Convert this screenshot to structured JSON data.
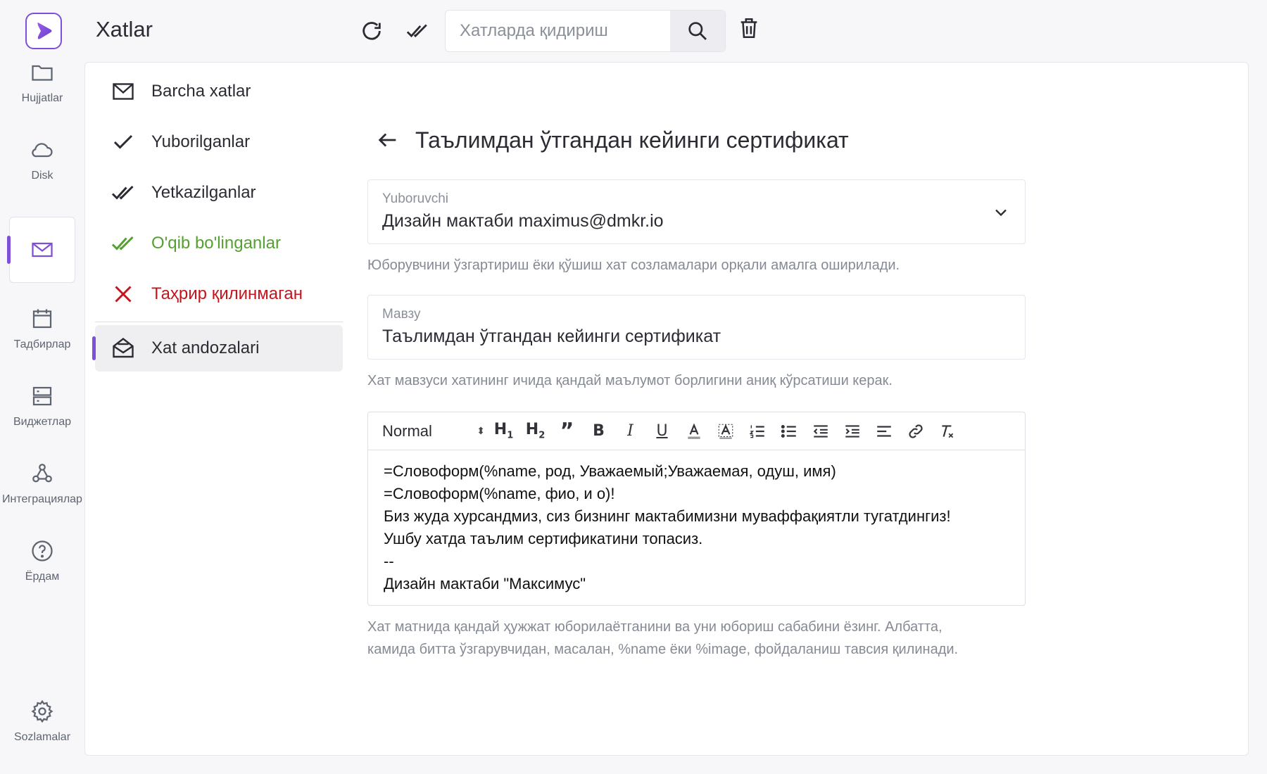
{
  "app": {
    "title": "Xatlar"
  },
  "rail": {
    "items": [
      {
        "label": "Hujjatlar"
      },
      {
        "label": "Disk"
      },
      {
        "label": ""
      },
      {
        "label": "Тадбирлар"
      },
      {
        "label": "Виджетлар"
      },
      {
        "label": "Интеграциялар"
      },
      {
        "label": "Ёрдам"
      },
      {
        "label": "Sozlamalar"
      }
    ]
  },
  "search": {
    "placeholder": "Хатларда қидириш"
  },
  "folders": [
    {
      "label": "Barcha xatlar",
      "icon": "envelope-icon"
    },
    {
      "label": "Yuborilganlar",
      "icon": "check-icon"
    },
    {
      "label": "Yetkazilganlar",
      "icon": "double-check-icon"
    },
    {
      "label": "O'qib bo'linganlar",
      "icon": "double-check-icon",
      "color": "#55a030"
    },
    {
      "label": "Таҳрир қилинмаган",
      "icon": "close-icon",
      "color": "#c4141c"
    },
    {
      "label": "Xat andozalari",
      "icon": "open-envelope-icon",
      "active": true
    }
  ],
  "form": {
    "title": "Таълимдан ўтгандан кейинги сертификат",
    "sender": {
      "label": "Yuboruvchi",
      "value": "Дизайн мактаби maximus@dmkr.io",
      "hint": "Юборувчини ўзгартириш ёки қўшиш хат созламалари орқали амалга оширилади."
    },
    "subject": {
      "label": "Мавзу",
      "value": "Таълимдан ўтгандан кейинги сертификат",
      "hint": "Хат мавзуси хатининг ичида қандай маълумот борлигини аниқ кўрсатиши керак."
    },
    "editor": {
      "format": "Normal",
      "lines": [
        "=Словоформ(%name, род, Уважаемый;Уважаемая, одуш, имя)",
        "=Словоформ(%name, фио, и о)!",
        "Биз жуда хурсандмиз, сиз бизнинг мактабимизни муваффақиятли тугатдингиз!",
        "Ушбу хатда таълим сертификатини топасиз.",
        "--",
        "Дизайн мактаби \"Максимус\""
      ],
      "hint_line1": "Хат матнида қандай ҳужжат юборилаётганини ва уни юбориш сабабини ёзинг. Албатта,",
      "hint_line2": "камида битта ўзгарувчидан, масалан, %name ёки %image, фойдаланиш тавсия қилинади."
    }
  },
  "colors": {
    "accent": "#7e4fd8",
    "success": "#55a030",
    "danger": "#c4141c"
  }
}
